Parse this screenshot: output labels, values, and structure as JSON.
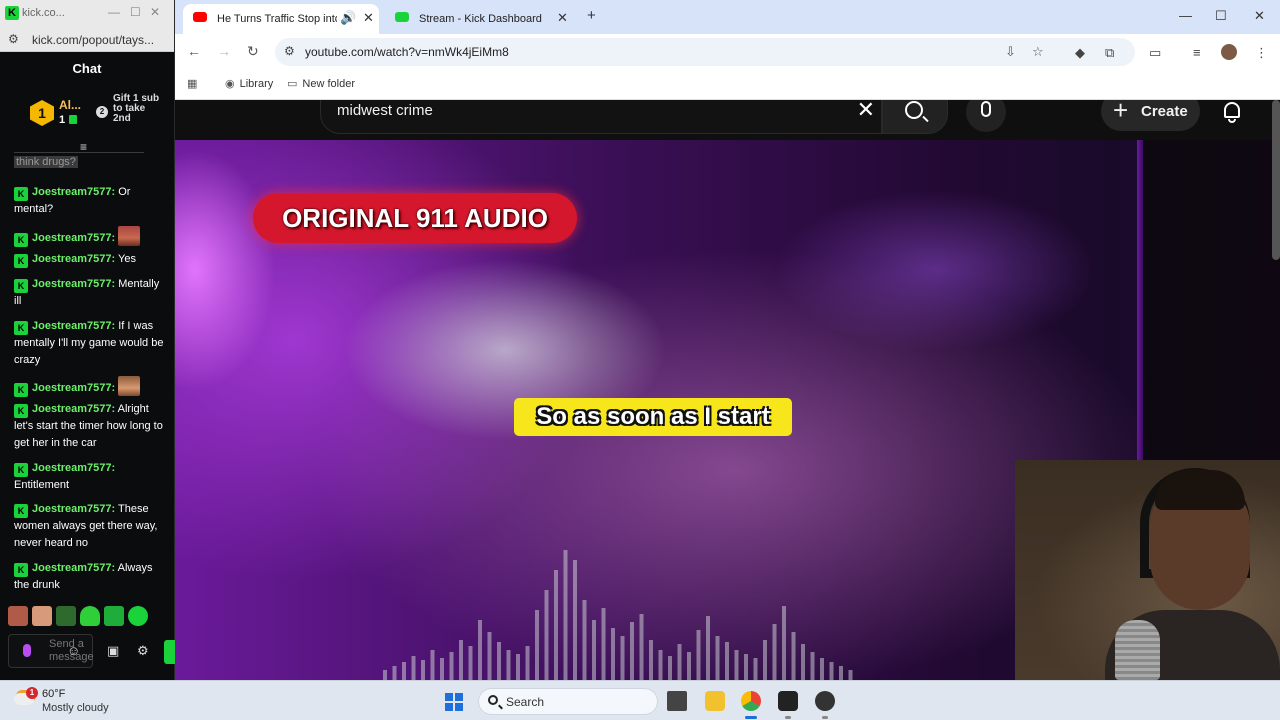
{
  "chat_window": {
    "tab_title": "kick.co...",
    "url": "kick.com/popout/tays...",
    "header": "Chat",
    "leaderboard": {
      "rank": "1",
      "name": "Al...",
      "count": "1",
      "gift_text": "Gift 1 sub to take 2nd"
    },
    "partial_message": "think drugs?",
    "messages": [
      {
        "user": "Joestream7577:",
        "text": "Or mental?"
      },
      {
        "user": "Joestream7577:",
        "text": ""
      },
      {
        "user": "Joestream7577:",
        "text": "Yes"
      },
      {
        "user": "Joestream7577:",
        "text": "Mentally ill"
      },
      {
        "user": "Joestream7577:",
        "text": "If I was mentally I'll my game would be crazy"
      },
      {
        "user": "Joestream7577:",
        "text": ""
      },
      {
        "user": "Joestream7577:",
        "text": "Alright let's start the timer how long to get her in the car"
      },
      {
        "user": "Joestream7577:",
        "text": "Entitlement"
      },
      {
        "user": "Joestream7577:",
        "text": "These women always get there way, never heard no"
      },
      {
        "user": "Joestream7577:",
        "text": "Always the drunk"
      }
    ],
    "input_placeholder": "Send a message"
  },
  "browser": {
    "tabs": [
      {
        "title": "He Turns Traffic Stop into F...",
        "active": true
      },
      {
        "title": "Stream - Kick Dashboard",
        "active": false
      }
    ],
    "url": "youtube.com/watch?v=nmWk4jEiMm8",
    "bookmarks": [
      "Library",
      "New folder"
    ]
  },
  "youtube": {
    "search_query": "midwest crime",
    "create_label": "Create"
  },
  "video": {
    "banner": "ORIGINAL 911 AUDIO",
    "caption": "So as soon as I start"
  },
  "taskbar": {
    "weather_temp": "60°F",
    "weather_condition": "Mostly cloudy",
    "weather_badge": "1",
    "search_label": "Search"
  },
  "colors": {
    "kick_green": "#53fc18",
    "yt_banner_red": "#d4172d",
    "caption_yellow": "#f8e61c"
  }
}
